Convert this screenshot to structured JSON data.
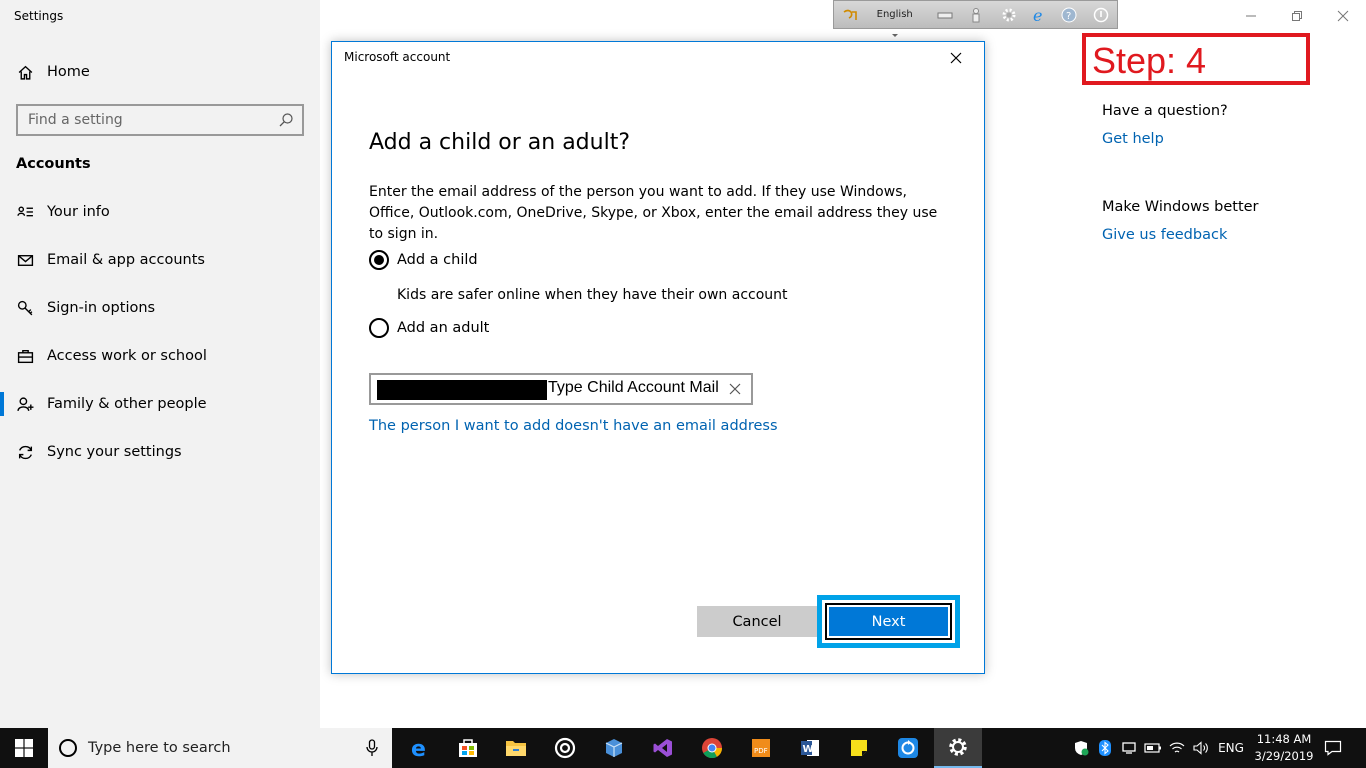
{
  "app": {
    "title": "Settings"
  },
  "sidebar": {
    "home_label": "Home",
    "search_placeholder": "Find a setting",
    "section_title": "Accounts",
    "items": [
      {
        "label": "Your info",
        "icon": "person-card-icon"
      },
      {
        "label": "Email & app accounts",
        "icon": "mail-icon"
      },
      {
        "label": "Sign-in options",
        "icon": "key-icon"
      },
      {
        "label": "Access work or school",
        "icon": "briefcase-icon"
      },
      {
        "label": "Family & other people",
        "icon": "add-person-icon",
        "active": true
      },
      {
        "label": "Sync your settings",
        "icon": "sync-icon"
      }
    ]
  },
  "langbar": {
    "language": "English"
  },
  "step": {
    "label": "Step: 4",
    "color": "#e0191f"
  },
  "help": {
    "question": "Have a question?",
    "get_help": "Get help",
    "improve": "Make Windows better",
    "feedback": "Give us feedback"
  },
  "dialog": {
    "title": "Microsoft account",
    "heading": "Add a child or an adult?",
    "description": "Enter the email address of the person you want to add. If they use Windows, Office, Outlook.com, OneDrive, Skype, or Xbox, enter the email address they use to sign in.",
    "option_child": "Add a child",
    "option_child_note": "Kids are safer online when they have their own account",
    "option_adult": "Add an adult",
    "selected_option": "child",
    "email_value": "Type Child Account Mail",
    "no_email_link": "The person I want to add doesn't have an email address",
    "cancel_label": "Cancel",
    "next_label": "Next"
  },
  "taskbar": {
    "search_placeholder": "Type here to search",
    "tray": {
      "language": "ENG",
      "time": "11:48 AM",
      "date": "3/29/2019"
    }
  },
  "colors": {
    "accent": "#0078d7",
    "link": "#0063b1",
    "highlight": "#00a2e8",
    "sidebar_bg": "#f2f2f2"
  }
}
